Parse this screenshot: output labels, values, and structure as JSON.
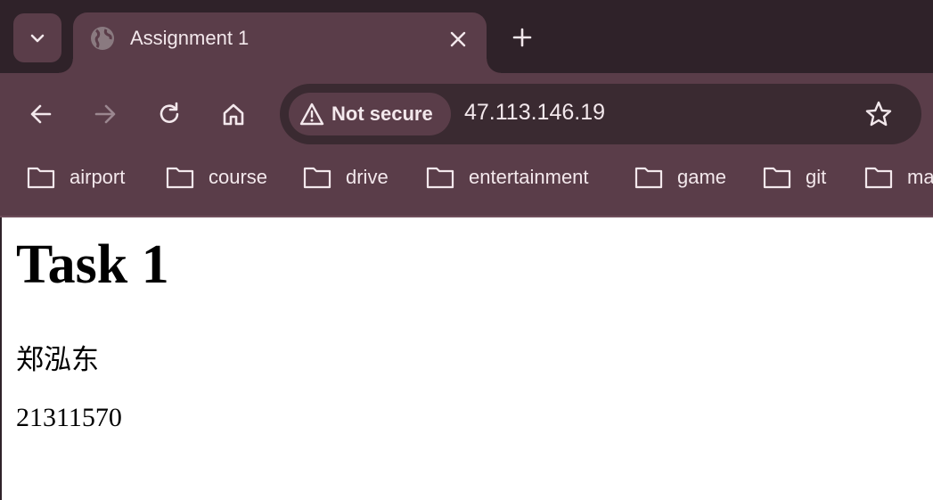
{
  "window": {
    "tab": {
      "title": "Assignment 1"
    }
  },
  "toolbar": {
    "security_label": "Not secure",
    "url": "47.113.146.19"
  },
  "bookmarks": [
    {
      "label": "airport"
    },
    {
      "label": "course"
    },
    {
      "label": "drive"
    },
    {
      "label": "entertainment"
    },
    {
      "label": "game"
    },
    {
      "label": "git"
    },
    {
      "label": "ma"
    }
  ],
  "page": {
    "heading": "Task 1",
    "name": "郑泓东",
    "student_id": "21311570"
  },
  "colors": {
    "frame": "#2f2229",
    "toolbar": "#5a3d49",
    "omnibox": "#3a2a31",
    "text_light": "#f3e8ec"
  },
  "icons": [
    "tab-search-icon",
    "globe-icon",
    "close-icon",
    "plus-icon",
    "back-arrow-icon",
    "forward-arrow-icon",
    "reload-icon",
    "home-icon",
    "warning-icon",
    "star-icon",
    "folder-icon"
  ]
}
